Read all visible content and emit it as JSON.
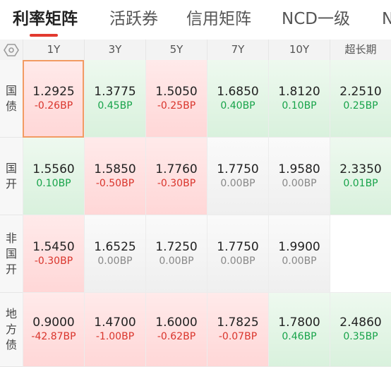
{
  "tabs": [
    "利率矩阵",
    "活跃券",
    "信用矩阵",
    "NCD一级",
    "N"
  ],
  "columns": [
    "1Y",
    "3Y",
    "5Y",
    "7Y",
    "10Y",
    "超长期"
  ],
  "rows": [
    {
      "label": [
        "国",
        "债"
      ],
      "cells": [
        {
          "value": "1.2925",
          "change": "-0.26BP",
          "tone": "up"
        },
        {
          "value": "1.3775",
          "change": "0.45BP",
          "tone": "down"
        },
        {
          "value": "1.5050",
          "change": "-0.25BP",
          "tone": "up"
        },
        {
          "value": "1.6850",
          "change": "0.40BP",
          "tone": "down"
        },
        {
          "value": "1.8120",
          "change": "0.10BP",
          "tone": "down"
        },
        {
          "value": "2.2510",
          "change": "0.25BP",
          "tone": "down"
        }
      ]
    },
    {
      "label": [
        "国",
        "开"
      ],
      "cells": [
        {
          "value": "1.5560",
          "change": "0.10BP",
          "tone": "down"
        },
        {
          "value": "1.5850",
          "change": "-0.50BP",
          "tone": "up"
        },
        {
          "value": "1.7760",
          "change": "-0.30BP",
          "tone": "up"
        },
        {
          "value": "1.7750",
          "change": "0.00BP",
          "tone": "flat"
        },
        {
          "value": "1.9580",
          "change": "0.00BP",
          "tone": "flat"
        },
        {
          "value": "2.3350",
          "change": "0.01BP",
          "tone": "down"
        }
      ]
    },
    {
      "label": [
        "非",
        "国",
        "开"
      ],
      "cells": [
        {
          "value": "1.5450",
          "change": "-0.30BP",
          "tone": "up"
        },
        {
          "value": "1.6525",
          "change": "0.00BP",
          "tone": "flat"
        },
        {
          "value": "1.7250",
          "change": "0.00BP",
          "tone": "flat"
        },
        {
          "value": "1.7750",
          "change": "0.00BP",
          "tone": "flat"
        },
        {
          "value": "1.9900",
          "change": "0.00BP",
          "tone": "flat"
        },
        {
          "value": "",
          "change": "",
          "tone": "empty"
        }
      ]
    },
    {
      "label": [
        "地",
        "方",
        "债"
      ],
      "cells": [
        {
          "value": "0.9000",
          "change": "-42.87BP",
          "tone": "up"
        },
        {
          "value": "1.4700",
          "change": "-1.00BP",
          "tone": "up"
        },
        {
          "value": "1.6000",
          "change": "-0.62BP",
          "tone": "up"
        },
        {
          "value": "1.7825",
          "change": "-0.07BP",
          "tone": "up"
        },
        {
          "value": "1.7800",
          "change": "0.46BP",
          "tone": "down"
        },
        {
          "value": "2.4860",
          "change": "0.35BP",
          "tone": "down"
        }
      ]
    }
  ],
  "colors": {
    "up": "#d9342b",
    "down": "#17a34a",
    "flat": "#888888",
    "accent": "#e23a2f",
    "selected_border": "#f29b63"
  },
  "icons": {
    "corner": "settings-hexagon-icon"
  }
}
